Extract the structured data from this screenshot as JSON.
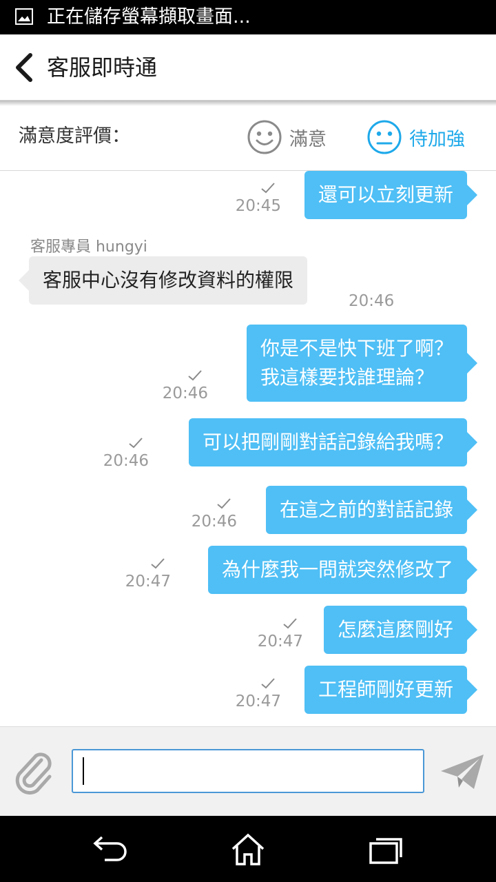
{
  "status_bar": {
    "notification_icon": "image-icon",
    "text": "正在儲存螢幕擷取畫面..."
  },
  "header": {
    "back_icon": "chevron-left-icon",
    "title": "客服即時通"
  },
  "rating": {
    "label": "滿意度評價：",
    "options": [
      {
        "icon": "smile-icon",
        "label": "滿意",
        "selected": false,
        "color": "#7a7a7a"
      },
      {
        "icon": "neutral-face-icon",
        "label": "待加強",
        "selected": true,
        "color": "#1ea9ea"
      }
    ]
  },
  "messages": [
    {
      "direction": "out",
      "text": "還可以立刻更新",
      "time": "20:45",
      "read": true
    },
    {
      "direction": "in",
      "sender": "客服專員 hungyi",
      "text": "客服中心沒有修改資料的權限",
      "time": "20:46"
    },
    {
      "direction": "out",
      "lines": [
        "你是不是快下班了啊？",
        "我這樣要找誰理論？"
      ],
      "time": "20:46",
      "read": true
    },
    {
      "direction": "out",
      "text": "可以把剛剛對話記錄給我嗎？",
      "time": "20:46",
      "read": true
    },
    {
      "direction": "out",
      "text": "在這之前的對話記錄",
      "time": "20:46",
      "read": true
    },
    {
      "direction": "out",
      "text": "為什麼我一問就突然修改了",
      "time": "20:47",
      "read": true
    },
    {
      "direction": "out",
      "text": "怎麼這麼剛好",
      "time": "20:47",
      "read": true
    },
    {
      "direction": "out",
      "text": "工程師剛好更新",
      "time": "20:47",
      "read": true
    }
  ],
  "input_bar": {
    "attach_icon": "paperclip-icon",
    "input_value": "",
    "send_icon": "send-icon"
  },
  "nav_bar": {
    "back_icon": "back-arrow-icon",
    "home_icon": "home-icon",
    "recent_icon": "recent-apps-icon"
  },
  "colors": {
    "outgoing_bubble": "#4fbff5",
    "incoming_bubble": "#ececec",
    "accent": "#1ea9ea",
    "input_border": "#4a97d6"
  }
}
